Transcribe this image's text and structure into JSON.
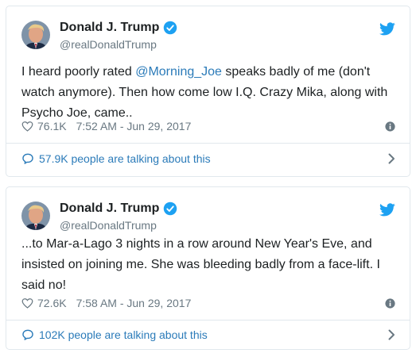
{
  "tweets": [
    {
      "author_name": "Donald J. Trump",
      "handle": "@realDonaldTrump",
      "text_before": "I heard poorly rated ",
      "mention": "@Morning_Joe",
      "text_after": " speaks badly of me (don't watch anymore). Then how come low I.Q. Crazy Mika, along with Psycho Joe, came..",
      "likes": "76.1K",
      "timestamp": "7:52 AM - Jun 29, 2017",
      "talking": "57.9K people are talking about this"
    },
    {
      "author_name": "Donald J. Trump",
      "handle": "@realDonaldTrump",
      "text_before": "...to Mar-a-Lago 3 nights in a row around New Year's Eve, and insisted on joining me. She was bleeding badly from a face-lift. I said no!",
      "mention": "",
      "text_after": "",
      "likes": "72.6K",
      "timestamp": "7:58 AM - Jun 29, 2017",
      "talking": "102K people are talking about this"
    }
  ],
  "colors": {
    "text": "#1c2022",
    "secondary": "#697882",
    "link": "#2b7bb9",
    "twitter_blue": "#1da1f2",
    "border": "#e1e8ed"
  },
  "icons": [
    "avatar",
    "verified-badge-icon",
    "twitter-bird-icon",
    "heart-icon",
    "info-icon",
    "comment-icon",
    "chevron-right-icon"
  ]
}
